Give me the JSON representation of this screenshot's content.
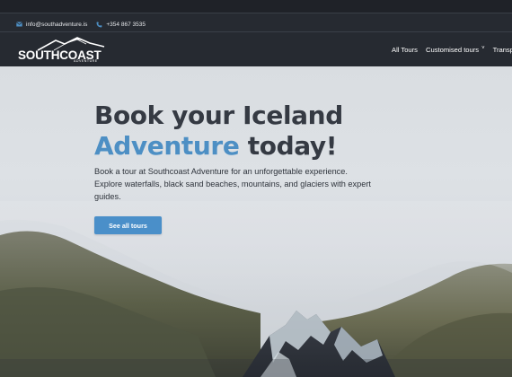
{
  "header": {
    "email": "info@southadventure.is",
    "phone": "+354 867 3535",
    "logo_text": "SOUTHCOAST",
    "logo_subtext": "ADVENTURE"
  },
  "nav": {
    "items": [
      {
        "label": "All Tours",
        "icon": null
      },
      {
        "label": "Customised tours",
        "icon": "chevron-down-icon"
      },
      {
        "label": "Transp",
        "icon": null
      }
    ]
  },
  "hero": {
    "headline_line1": "Book your Iceland",
    "headline_accent": "Adventure",
    "headline_rest": " today!",
    "subtext": "Book a tour at Southcoast Adventure for an unforgettable experience. Explore waterfalls, black sand beaches, mountains, and glaciers with expert guides.",
    "cta_label": "See all tours"
  },
  "colors": {
    "header_bg": "#262a31",
    "accent_blue": "#4d8fc4",
    "button_blue": "#4a8fc9",
    "headline_dark": "#353a43"
  }
}
